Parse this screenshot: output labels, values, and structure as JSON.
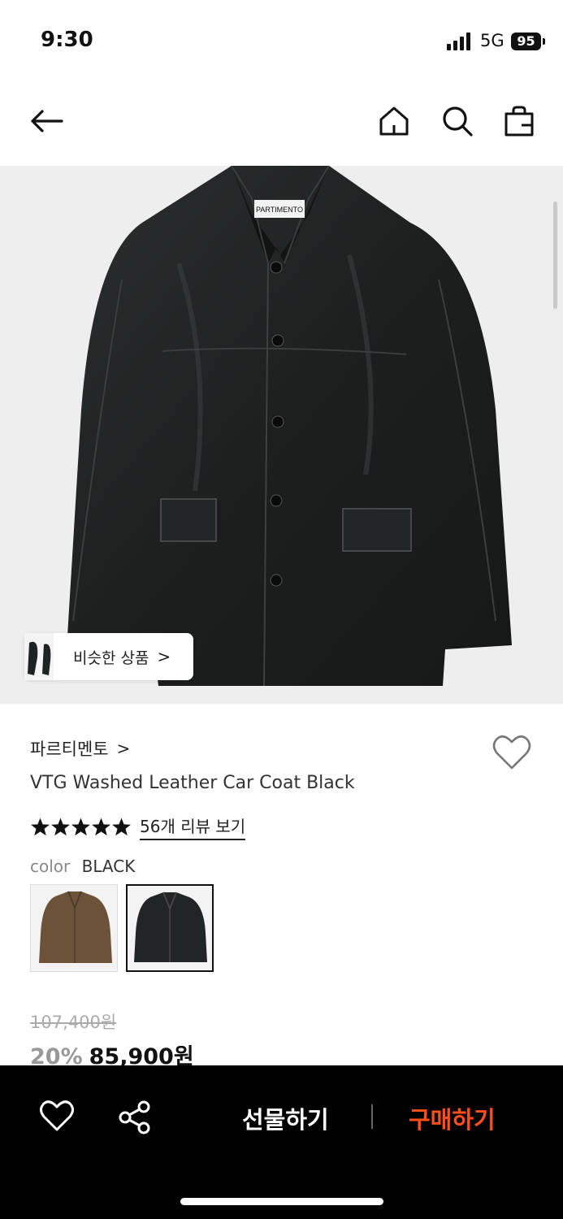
{
  "status": {
    "time": "9:30",
    "network": "5G",
    "battery": "95"
  },
  "nav": {
    "back_icon": "arrow-left-icon",
    "home_icon": "home-icon",
    "search_icon": "search-icon",
    "bag_icon": "shopping-bag-icon"
  },
  "hero": {
    "similar_label": "비슷한 상품",
    "similar_chevron": ">",
    "garment_tag": "PARTIMENTO"
  },
  "product": {
    "brand": "파르티멘토",
    "brand_chevron": ">",
    "title": "VTG Washed Leather Car Coat Black",
    "rating_stars": 5,
    "review_link": "56개 리뷰 보기",
    "color_key": "color",
    "color_value": "BLACK",
    "swatches": [
      {
        "color": "brown",
        "selected": false
      },
      {
        "color": "black",
        "selected": true
      }
    ],
    "original_price": "107,400원",
    "discount": "20%",
    "price": "85,900원"
  },
  "bottom": {
    "gift_label": "선물하기",
    "buy_label": "구매하기"
  },
  "colors": {
    "accent": "#ff4f1a",
    "bottom_bar": "#000000",
    "hero_bg": "#eeeeee"
  }
}
